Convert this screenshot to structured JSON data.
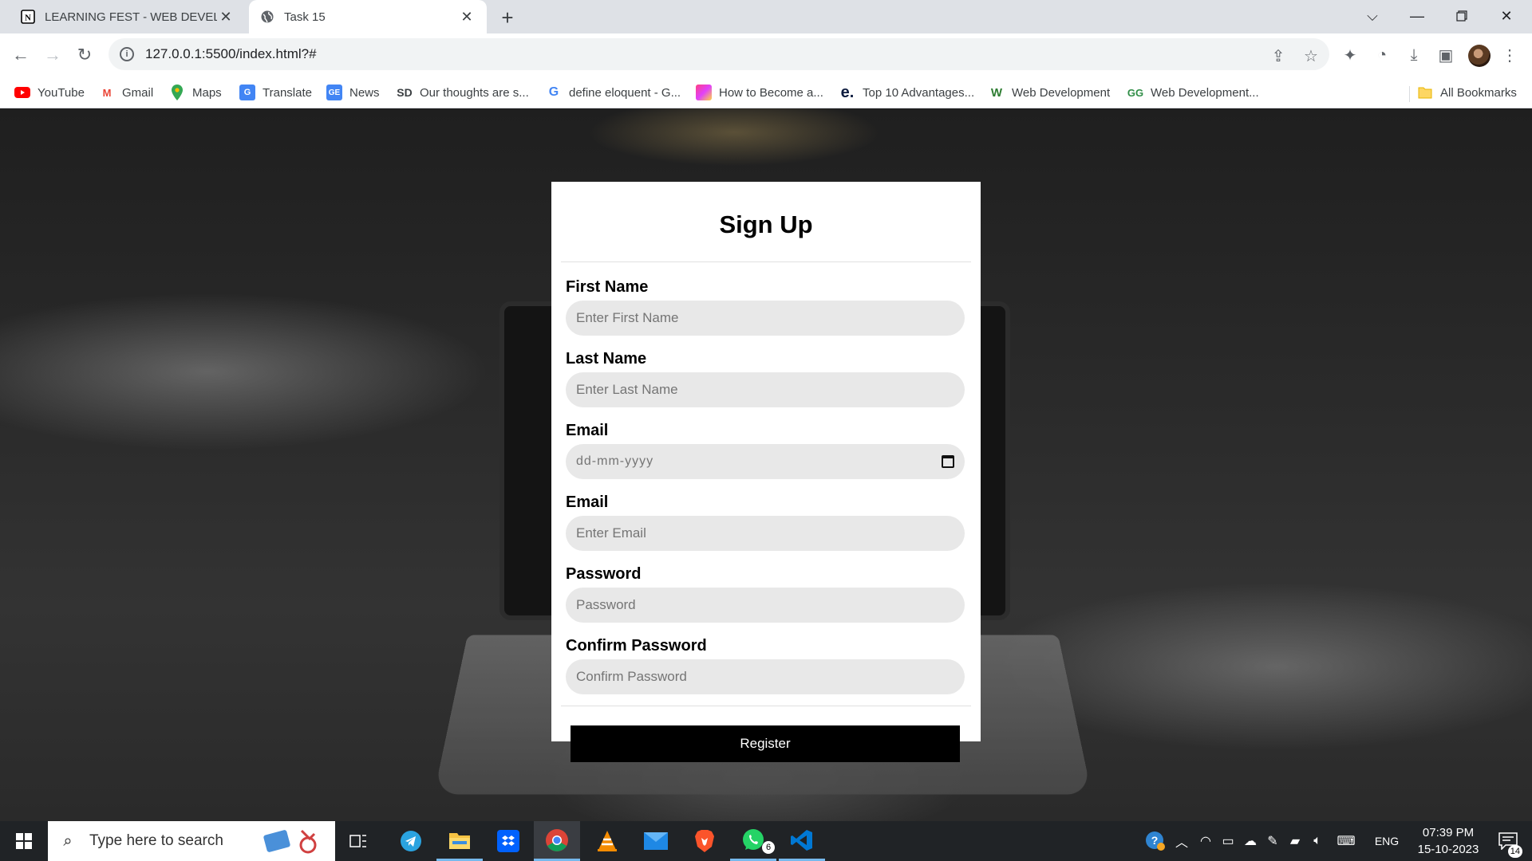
{
  "browser": {
    "tabs": [
      {
        "title": "LEARNING FEST - WEB DEVELOPM",
        "favicon": "notion-icon",
        "active": false
      },
      {
        "title": "Task 15",
        "favicon": "globe-icon",
        "active": true
      }
    ],
    "new_tab_label": "+",
    "url": "127.0.0.1:5500/index.html?#",
    "bookmarks": [
      {
        "label": "YouTube",
        "icon": "youtube-icon",
        "color": "#ff0000"
      },
      {
        "label": "Gmail",
        "icon": "gmail-icon",
        "color": "#ea4335"
      },
      {
        "label": "Maps",
        "icon": "maps-icon",
        "color": "#34a853"
      },
      {
        "label": "Translate",
        "icon": "translate-icon",
        "color": "#4285f4"
      },
      {
        "label": "News",
        "icon": "news-icon",
        "color": "#4285f4"
      },
      {
        "label": "Our thoughts are s...",
        "icon": "sd-icon",
        "color": "#202124"
      },
      {
        "label": "define eloquent - G...",
        "icon": "google-icon",
        "color": "#4285f4"
      },
      {
        "label": "How to Become a...",
        "icon": "gradient-square-icon",
        "color": "#e040fb"
      },
      {
        "label": "Top 10 Advantages...",
        "icon": "e-icon",
        "color": "#202124"
      },
      {
        "label": "Web Development",
        "icon": "w-icon",
        "color": "#2e7d32"
      },
      {
        "label": "Web Development...",
        "icon": "gfg-icon",
        "color": "#2f8d46"
      }
    ],
    "all_bookmarks_label": "All Bookmarks"
  },
  "form": {
    "title": "Sign Up",
    "fields": [
      {
        "label": "First Name",
        "placeholder": "Enter First Name",
        "type": "text"
      },
      {
        "label": "Last Name",
        "placeholder": "Enter Last Name",
        "type": "text"
      },
      {
        "label": "Email",
        "placeholder": "dd-mm-yyyy",
        "type": "date"
      },
      {
        "label": "Email",
        "placeholder": "Enter Email",
        "type": "email"
      },
      {
        "label": "Password",
        "placeholder": "Password",
        "type": "password"
      },
      {
        "label": "Confirm Password",
        "placeholder": "Confirm Password",
        "type": "password"
      }
    ],
    "submit_label": "Register"
  },
  "taskbar": {
    "search_placeholder": "Type here to search",
    "apps": [
      {
        "name": "task-view-icon"
      },
      {
        "name": "telegram-icon"
      },
      {
        "name": "file-explorer-icon"
      },
      {
        "name": "dropbox-icon"
      },
      {
        "name": "chrome-icon"
      },
      {
        "name": "vlc-icon"
      },
      {
        "name": "mail-icon"
      },
      {
        "name": "brave-icon"
      },
      {
        "name": "whatsapp-icon",
        "badge": "6"
      },
      {
        "name": "vscode-icon"
      }
    ],
    "language": "ENG",
    "time": "07:39 PM",
    "date": "15-10-2023",
    "notification_count": "14"
  }
}
